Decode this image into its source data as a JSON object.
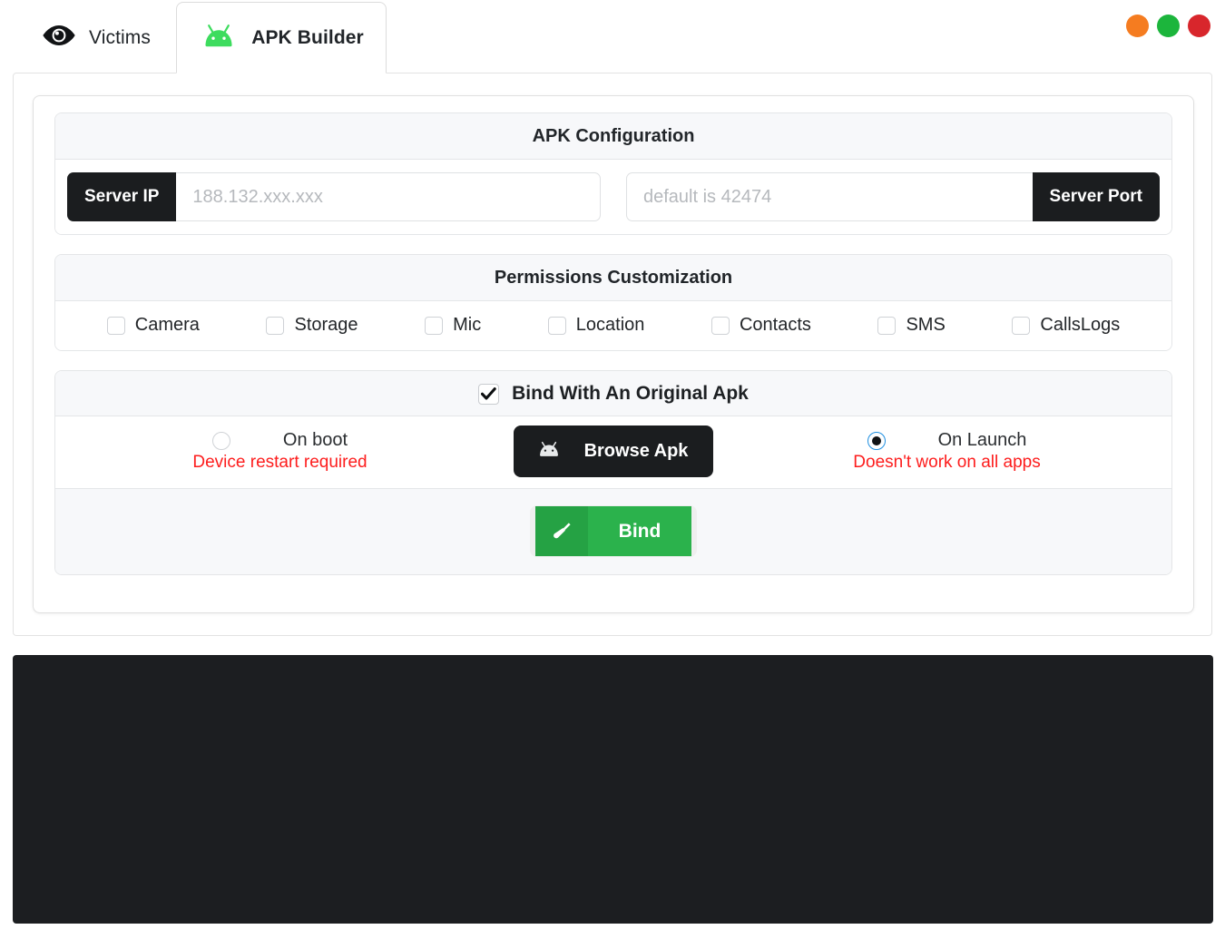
{
  "window_controls": [
    {
      "name": "minimize-button",
      "color": "#f57c20"
    },
    {
      "name": "maximize-button",
      "color": "#1cb53c"
    },
    {
      "name": "close-button",
      "color": "#d8262c"
    }
  ],
  "tabs": [
    {
      "id": "victims",
      "label": "Victims",
      "icon": "eye-icon",
      "active": false
    },
    {
      "id": "apk-builder",
      "label": "APK Builder",
      "icon": "android-icon",
      "active": true
    }
  ],
  "apk_configuration": {
    "title": "APK Configuration",
    "server_ip": {
      "addon_label": "Server IP",
      "placeholder": "188.132.xxx.xxx",
      "value": ""
    },
    "server_port": {
      "addon_label": "Server Port",
      "placeholder": "default is 42474",
      "value": ""
    }
  },
  "permissions": {
    "title": "Permissions Customization",
    "items": [
      {
        "label": "Camera",
        "checked": false
      },
      {
        "label": "Storage",
        "checked": false
      },
      {
        "label": "Mic",
        "checked": false
      },
      {
        "label": "Location",
        "checked": false
      },
      {
        "label": "Contacts",
        "checked": false
      },
      {
        "label": "SMS",
        "checked": false
      },
      {
        "label": "CallsLogs",
        "checked": false
      }
    ]
  },
  "bind": {
    "title": "Bind With An Original Apk",
    "enabled": true,
    "on_boot": {
      "label": "On boot",
      "note": "Device restart required",
      "selected": false
    },
    "on_launch": {
      "label": "On Launch",
      "note": "Doesn't work on all apps",
      "selected": true
    },
    "browse_button": {
      "label": "Browse Apk",
      "icon": "android-icon"
    },
    "bind_button": {
      "label": "Bind",
      "icon": "screwdriver-icon"
    }
  },
  "colors": {
    "accent_green": "#2bb24c",
    "accent_green_dark": "#25a244",
    "danger_red": "#fd1d1d",
    "dark": "#1b1d1f",
    "console": "#1c1e21",
    "android_green": "#3ddc5e"
  },
  "console_output": ""
}
